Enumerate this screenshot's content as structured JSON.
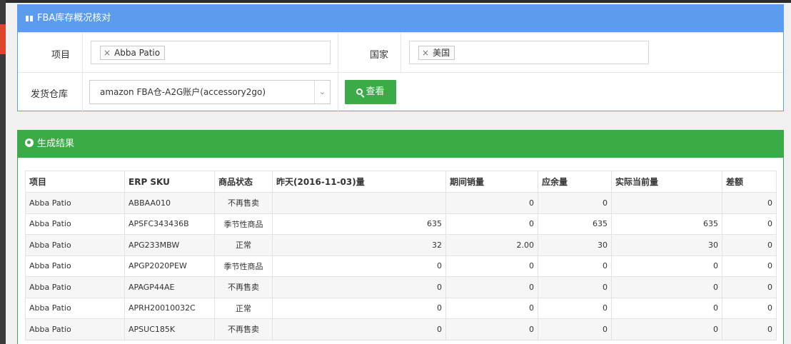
{
  "filter_panel": {
    "title": "FBA库存概况核对",
    "icon": "gift-icon",
    "project_label": "项目",
    "project_tag": "Abba Patio",
    "country_label": "国家",
    "country_tag": "美国",
    "warehouse_label": "发货仓库",
    "warehouse_value": "amazon FBA仓-A2G账户(accessory2go)",
    "view_button": "查看",
    "tag_remove_glyph": "×"
  },
  "result_panel": {
    "title": "生成结果",
    "icon": "globe-icon"
  },
  "table": {
    "headers": [
      "项目",
      "ERP SKU",
      "商品状态",
      "昨天(2016-11-03)量",
      "期间销量",
      "应余量",
      "实际当前量",
      "差额"
    ],
    "rows": [
      [
        "Abba Patio",
        "ABBAA010",
        "不再售卖",
        "",
        "0",
        "0",
        "",
        "0"
      ],
      [
        "Abba Patio",
        "APSFC343436B",
        "季节性商品",
        "635",
        "0",
        "635",
        "635",
        "0"
      ],
      [
        "Abba Patio",
        "APG233MBW",
        "正常",
        "32",
        "2.00",
        "30",
        "30",
        "0"
      ],
      [
        "Abba Patio",
        "APGP2020PEW",
        "季节性商品",
        "0",
        "0",
        "0",
        "0",
        "0"
      ],
      [
        "Abba Patio",
        "APAGP44AE",
        "不再售卖",
        "0",
        "0",
        "0",
        "0",
        "0"
      ],
      [
        "Abba Patio",
        "APRH20010032C",
        "正常",
        "0",
        "0",
        "0",
        "0",
        "0"
      ],
      [
        "Abba Patio",
        "APSUC185K",
        "不再售卖",
        "0",
        "0",
        "0",
        "0",
        "0"
      ]
    ]
  },
  "colors": {
    "filter_header": "#5b9cee",
    "result_header": "#3bab48",
    "button": "#3bab48"
  }
}
